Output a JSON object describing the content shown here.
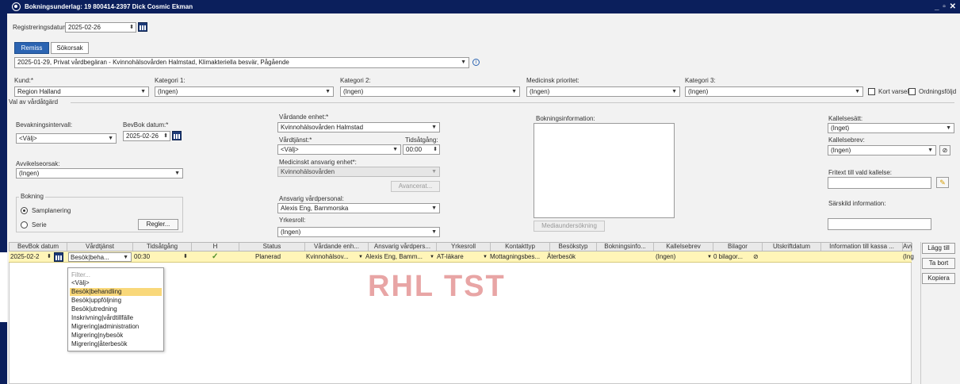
{
  "window": {
    "title": "Bokningsunderlag: 19 800414-2397 Dick Cosmic Ekman",
    "controls": "_ ▫ ✕"
  },
  "registration": {
    "label": "Registreringsdatum:",
    "value": "2025-02-26"
  },
  "tabs": [
    "Remiss",
    "Sökorsak"
  ],
  "remiss": {
    "value": "2025-01-29, Privat vårdbegäran - Kvinnohälsovården Halmstad, Klimakteriella besvär, Pågående",
    "info": "i"
  },
  "top_fields": {
    "kund": {
      "label": "Kund:*",
      "value": "Region Halland"
    },
    "kat1": {
      "label": "Kategori 1:",
      "value": "(Ingen)"
    },
    "kat2": {
      "label": "Kategori 2:",
      "value": "(Ingen)"
    },
    "med": {
      "label": "Medicinsk prioritet:",
      "value": "(Ingen)"
    },
    "kat3": {
      "label": "Kategori 3:",
      "value": "(Ingen)"
    },
    "kortvarsel": "Kort varsel",
    "ordning": "Ordningsföljd"
  },
  "val": {
    "section": "Val av vårdåtgärd",
    "bevak": {
      "label": "Bevakningsintervall:",
      "value": "<Välj>"
    },
    "bevbok": {
      "label": "BevBok datum:*",
      "value": "2025-02-26"
    },
    "avvik": {
      "label": "Avvikelseorsak:",
      "value": "(Ingen)"
    },
    "bokning": {
      "label": "Bokning",
      "samplanering": "Samplanering",
      "serie": "Serie",
      "regler": "Regler..."
    },
    "vardande": {
      "label": "Vårdande enhet:*",
      "value": "Kvinnohälsovården Halmstad"
    },
    "vardtjanst": {
      "label": "Vårdtjänst:*",
      "value": "<Välj>"
    },
    "tidsatgang": {
      "label": "Tidsåtgång:",
      "value": "00:00"
    },
    "medansv": {
      "label": "Medicinskt ansvarig enhet*:",
      "value": "Kvinnohälsovården"
    },
    "avancerat": "Avancerat...",
    "ansvpers": {
      "label": "Ansvarig vårdpersonal:",
      "value": "Alexis Eng, Barnmorska"
    },
    "yrkesroll": {
      "label": "Yrkesroll:",
      "value": "(Ingen)"
    },
    "bokinfo": {
      "label": "Bokningsinformation:"
    },
    "mediabtn": "Mediaundersökning",
    "kallsatt": {
      "label": "Kallelsesätt:",
      "value": "(Inget)"
    },
    "kallbrev": {
      "label": "Kallelsebrev:",
      "value": "(Ingen)"
    },
    "fritext": {
      "label": "Fritext till vald kallelse:"
    },
    "sarskild": {
      "label": "Särskild information:"
    }
  },
  "grid": {
    "headers": [
      "BevBok datum",
      "Vårdtjänst",
      "Tidsåtgång",
      "H",
      "Status",
      "Vårdande enh...",
      "Ansvarig vårdpers...",
      "Yrkesroll",
      "Kontakttyp",
      "Besökstyp",
      "Bokningsinfo...",
      "Kallelsebrev",
      "Bilagor",
      "Utskriftdatum",
      "Information till kassa ...",
      "Avvi"
    ],
    "row": {
      "date": "2025-02-2",
      "vardtjanst": "Besök|beha...",
      "tid": "00:30",
      "h": "✓",
      "status": "Planerad",
      "enhet": "Kvinnohälsov...",
      "pers": "Alexis Eng, Bamm...",
      "yrke": "AT-läkare",
      "kontakt": "Mottagningsbes...",
      "besok": "Återbesök",
      "bokinfo": "",
      "kallbrev": "(Ingen)",
      "bilagor": "0 bilagor...",
      "utskrift": "",
      "kassa": "",
      "avvi": "(Ing"
    }
  },
  "side_buttons": [
    "Lägg till",
    "Ta bort",
    "Kopiera"
  ],
  "watermark": "RHL TST",
  "dropdown": {
    "filter": "Filter...",
    "items": [
      "<Välj>",
      "Besök|behandling",
      "Besök|uppföljning",
      "Besök|utredning",
      "Inskrivning|vårdtillfälle",
      "Migrering|administration",
      "Migrering|nybesök",
      "Migrering|återbesök"
    ],
    "selected_index": 1
  }
}
